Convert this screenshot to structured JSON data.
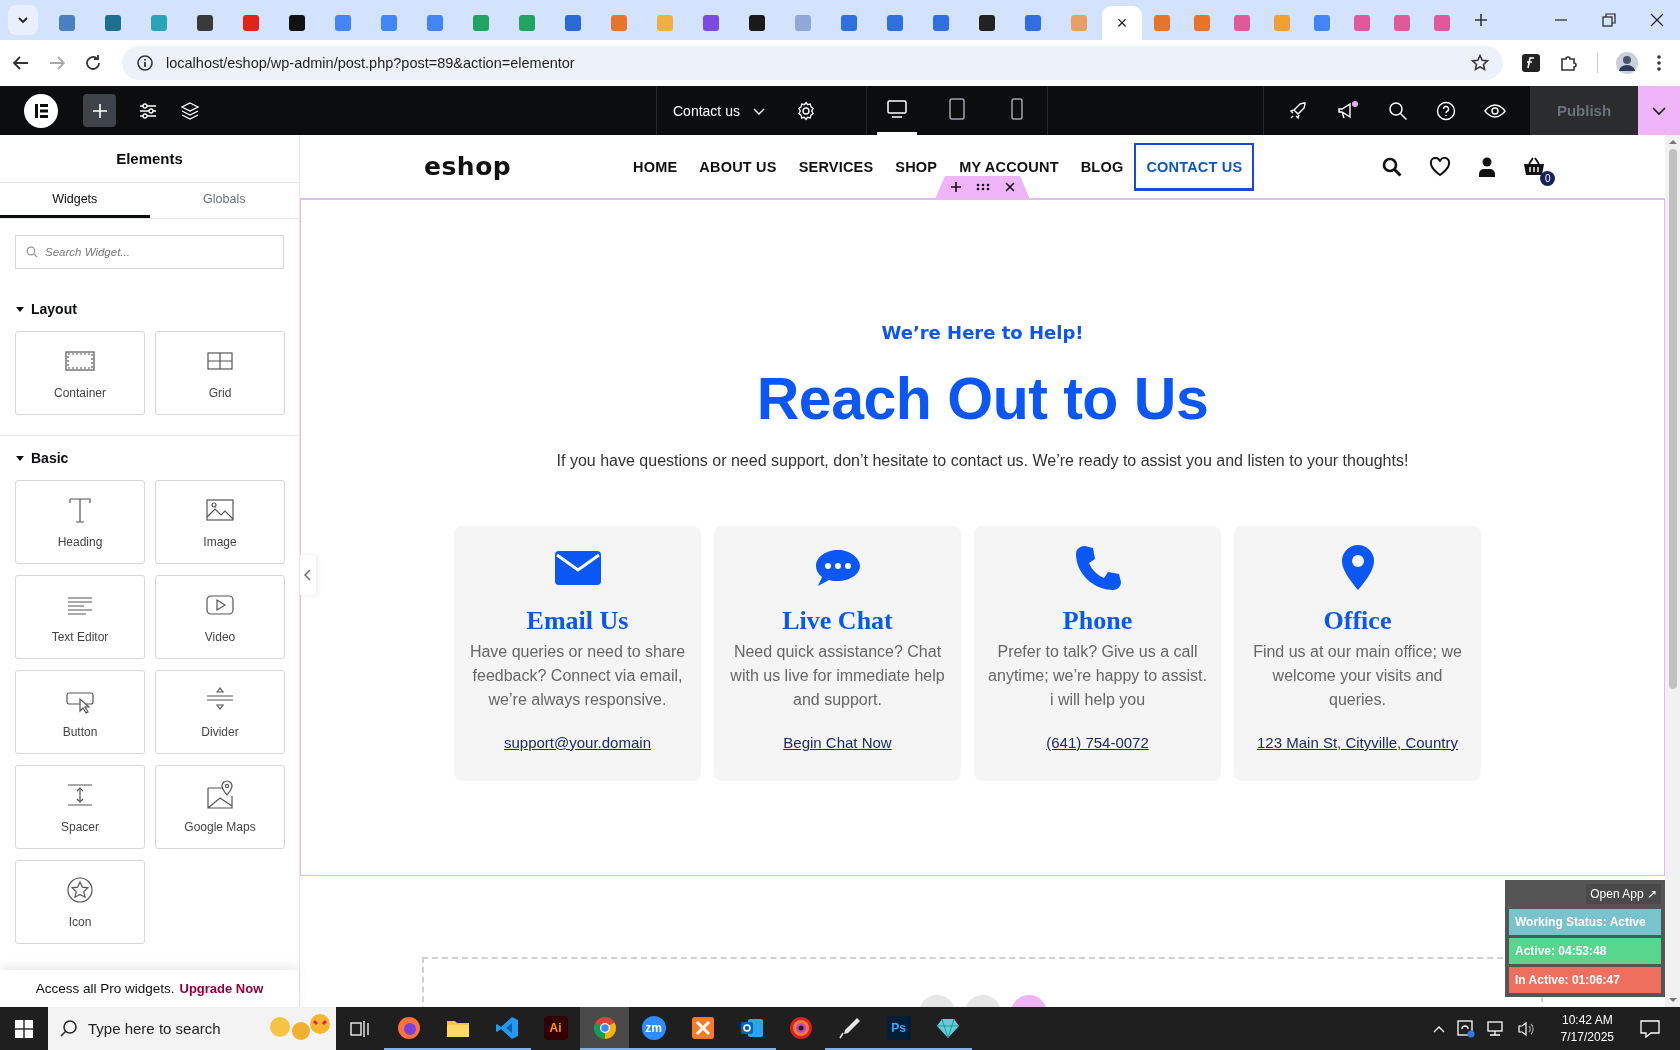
{
  "browser": {
    "tabs": [
      {
        "selected": false,
        "color": "#4a7fc1"
      },
      {
        "selected": false,
        "color": "#1d6f8f"
      },
      {
        "selected": false,
        "color": "#2aa5b8"
      },
      {
        "selected": false,
        "color": "#3a3a3a"
      },
      {
        "selected": false,
        "color": "#e62117"
      },
      {
        "selected": false,
        "color": "#111111"
      },
      {
        "selected": false,
        "color": "#4285f4"
      },
      {
        "selected": false,
        "color": "#4285f4"
      },
      {
        "selected": false,
        "color": "#4285f4"
      },
      {
        "selected": false,
        "color": "#1fa463"
      },
      {
        "selected": false,
        "color": "#1fa463"
      },
      {
        "selected": false,
        "color": "#2a6ad8"
      },
      {
        "selected": false,
        "color": "#e8742a"
      },
      {
        "selected": false,
        "color": "#f0b040"
      },
      {
        "selected": false,
        "color": "#7b4ae0"
      },
      {
        "selected": false,
        "color": "#1a1a1a"
      },
      {
        "selected": false,
        "color": "#8fa8d8"
      },
      {
        "selected": false,
        "color": "#2f6fe0"
      },
      {
        "selected": false,
        "color": "#2f6fe0"
      },
      {
        "selected": false,
        "color": "#2f6fe0"
      },
      {
        "selected": false,
        "color": "#222222"
      },
      {
        "selected": false,
        "color": "#2f6fe0"
      },
      {
        "selected": false,
        "color": "#e8a060"
      },
      {
        "selected": true,
        "close": "×"
      },
      {
        "selected": false,
        "color": "#e8742a"
      },
      {
        "selected": false,
        "color": "#e8742a"
      },
      {
        "selected": false,
        "color": "#e05a9a"
      },
      {
        "selected": false,
        "color": "#f0a030"
      },
      {
        "selected": false,
        "color": "#4285f4"
      },
      {
        "selected": false,
        "color": "#e05a9a"
      },
      {
        "selected": false,
        "color": "#e05a9a"
      },
      {
        "selected": false,
        "color": "#e05a9a"
      }
    ],
    "address": "localhost/eshop/wp-admin/post.php?post=89&action=elementor"
  },
  "editor_bar": {
    "page_title": "Contact us",
    "devices": [
      {
        "kind": "desktop",
        "selected": true
      },
      {
        "kind": "tablet",
        "selected": false
      },
      {
        "kind": "mobile",
        "selected": false
      }
    ],
    "publish": {
      "label": "Publish",
      "disabled": true
    }
  },
  "panel": {
    "title": "Elements",
    "tabs": [
      {
        "label": "Widgets",
        "selected": true
      },
      {
        "label": "Globals",
        "selected": false
      }
    ],
    "search": {
      "placeholder": "Search Widget..."
    },
    "categories": [
      {
        "name": "Layout",
        "expanded": true,
        "widgets": [
          {
            "kind": "container",
            "label": "Container"
          },
          {
            "kind": "grid",
            "label": "Grid"
          }
        ]
      },
      {
        "name": "Basic",
        "expanded": true,
        "widgets": [
          {
            "kind": "heading",
            "label": "Heading"
          },
          {
            "kind": "image",
            "label": "Image"
          },
          {
            "kind": "text-editor",
            "label": "Text Editor"
          },
          {
            "kind": "video",
            "label": "Video"
          },
          {
            "kind": "button",
            "label": "Button"
          },
          {
            "kind": "divider",
            "label": "Divider"
          },
          {
            "kind": "spacer",
            "label": "Spacer"
          },
          {
            "kind": "google-maps",
            "label": "Google Maps"
          },
          {
            "kind": "icon",
            "label": "Icon"
          }
        ]
      }
    ],
    "promo": {
      "text": "Access all Pro widgets.",
      "link": "Upgrade Now"
    }
  },
  "site": {
    "logo": "eshop",
    "nav": [
      {
        "label": "HOME",
        "selected": false
      },
      {
        "label": "ABOUT US",
        "selected": false
      },
      {
        "label": "SERVICES",
        "selected": false
      },
      {
        "label": "SHOP",
        "selected": false
      },
      {
        "label": "MY ACCOUNT",
        "selected": false
      },
      {
        "label": "BLOG",
        "selected": false
      },
      {
        "label": "CONTACT US",
        "selected": true
      }
    ],
    "cart_count": "0",
    "eyebrow": "We’re Here to Help!",
    "heading": "Reach Out to Us",
    "intro": "If you have questions or need support, don’t hesitate to contact us. We’re ready to assist you and listen to your thoughts!",
    "cards": [
      {
        "kind": "email",
        "title": "Email Us",
        "text": "Have queries or need to share feedback? Connect via email, we’re always responsive.",
        "link": "support@your.domain"
      },
      {
        "kind": "chat",
        "title": "Live Chat",
        "text": "Need quick assistance? Chat with us live for immediate help and support.",
        "link": "Begin Chat Now"
      },
      {
        "kind": "phone",
        "title": "Phone",
        "text": "Prefer to talk? Give us a call anytime; we’re happy to assist. i will help you",
        "link": "(641) 754-0072"
      },
      {
        "kind": "office",
        "title": "Office",
        "text": "Find us at our main office; we welcome your visits and queries.",
        "link": "123 Main St, Cityville, Country"
      }
    ]
  },
  "tracker": {
    "open_app": "Open App ↗",
    "rows": [
      {
        "text": "Working Status: Active",
        "color": "#79c3cd"
      },
      {
        "text": "Active: 04:53:48",
        "color": "#58d68d"
      },
      {
        "text": "In Active: 01:06:47",
        "color": "#ef6f5f"
      }
    ]
  },
  "taskbar": {
    "search_placeholder": "Type here to search",
    "apps": [
      {
        "kind": "firefox",
        "selected": false,
        "running": true
      },
      {
        "kind": "files",
        "selected": false,
        "running": true
      },
      {
        "kind": "vscode",
        "selected": false,
        "running": true
      },
      {
        "kind": "illustrator",
        "label": "Ai",
        "selected": false,
        "running": false
      },
      {
        "kind": "chrome",
        "selected": true,
        "running": true
      },
      {
        "kind": "zoom",
        "label": "zm",
        "selected": false,
        "running": true
      },
      {
        "kind": "xampp",
        "selected": false,
        "running": true
      },
      {
        "kind": "outlook",
        "selected": false,
        "running": true
      },
      {
        "kind": "creative-cloud",
        "selected": false,
        "running": false
      },
      {
        "kind": "pen",
        "selected": false,
        "running": true
      },
      {
        "kind": "photoshop",
        "label": "Ps",
        "selected": false,
        "running": true
      },
      {
        "kind": "gem",
        "selected": false,
        "running": true
      }
    ],
    "time": "10:42 AM",
    "date": "7/17/2025"
  }
}
